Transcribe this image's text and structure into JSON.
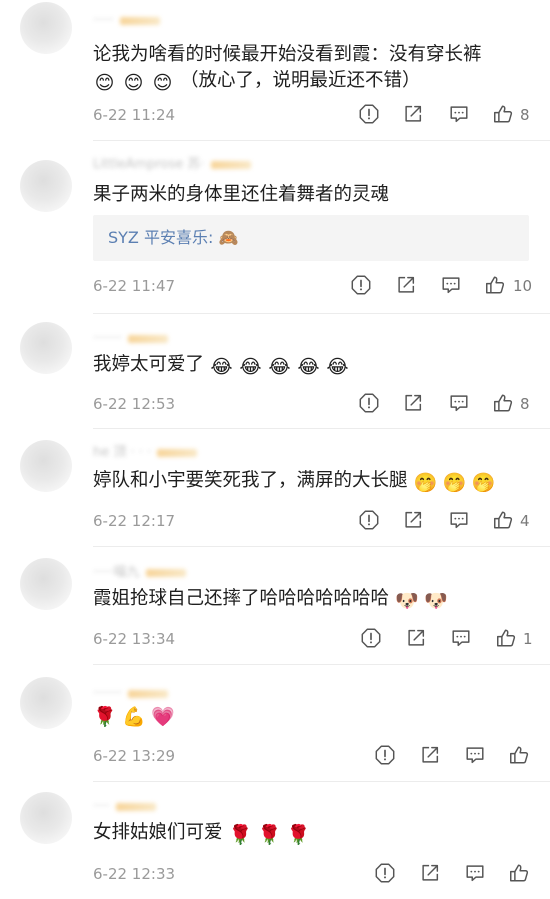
{
  "comments": [
    {
      "username": "·····",
      "content": "论我为啥看的时候最开始没看到霞：没有穿长裤",
      "content2": "（放心了，说明最近还不错）",
      "emojis": [
        "😊",
        "😊",
        "😊"
      ],
      "time": "6-22 11:24",
      "likes": "8"
    },
    {
      "username": "LittleAmprose 苏·",
      "content": "果子两米的身体里还住着舞者的灵魂",
      "reply": {
        "author": "SYZ 平安喜乐:",
        "text": " 🙈"
      },
      "time": "6-22 11:47",
      "likes": "10"
    },
    {
      "username": "·······",
      "content": "我婷太可爱了",
      "emojis": [
        "😂",
        "😂",
        "😂",
        "😂",
        "😂"
      ],
      "time": "6-22 12:53",
      "likes": "8"
    },
    {
      "username": "he 顶 · · ·",
      "content": "婷队和小宇要笑死我了，满屏的大长腿",
      "emojis": [
        "🤭",
        "🤭",
        "🤭"
      ],
      "time": "6-22 12:17",
      "likes": "4"
    },
    {
      "username": "·····喵九",
      "content": "霞姐抢球自己还摔了哈哈哈哈哈哈哈",
      "emojis": [
        "🐶",
        "🐶"
      ],
      "time": "6-22 13:34",
      "likes": "1"
    },
    {
      "username": "·······",
      "content": "",
      "emojis": [
        "🌹",
        "💪",
        "💗"
      ],
      "time": "6-22 13:29",
      "likes": ""
    },
    {
      "username": "····",
      "content": "女排姑娘们可爱",
      "emojis": [
        "🌹",
        "🌹",
        "🌹"
      ],
      "time": "6-22 12:33",
      "likes": ""
    }
  ],
  "icons": {
    "report": "report-icon",
    "share": "share-icon",
    "reply": "comment-icon",
    "like": "thumbs-up-icon"
  },
  "colors": {
    "link": "#5b7fb2",
    "meta": "#9a9a9a",
    "badge": "#f6c97e"
  }
}
